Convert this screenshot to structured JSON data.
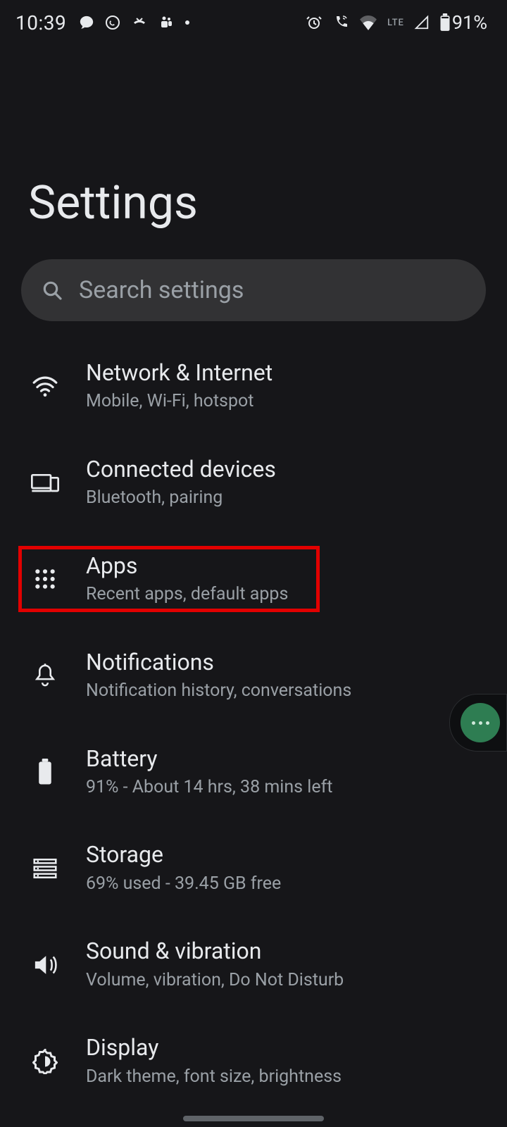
{
  "status_bar": {
    "time": "10:39",
    "battery": "91%",
    "network_indicator": "LTE"
  },
  "page": {
    "title": "Settings"
  },
  "search": {
    "placeholder": "Search settings"
  },
  "settings": [
    {
      "id": "network",
      "title": "Network & Internet",
      "subtitle": "Mobile, Wi-Fi, hotspot"
    },
    {
      "id": "connected",
      "title": "Connected devices",
      "subtitle": "Bluetooth, pairing"
    },
    {
      "id": "apps",
      "title": "Apps",
      "subtitle": "Recent apps, default apps",
      "highlighted": true
    },
    {
      "id": "notifications",
      "title": "Notifications",
      "subtitle": "Notification history, conversations"
    },
    {
      "id": "battery",
      "title": "Battery",
      "subtitle": "91% - About 14 hrs, 38 mins left"
    },
    {
      "id": "storage",
      "title": "Storage",
      "subtitle": "69% used - 39.45 GB free"
    },
    {
      "id": "sound",
      "title": "Sound & vibration",
      "subtitle": "Volume, vibration, Do Not Disturb"
    },
    {
      "id": "display",
      "title": "Display",
      "subtitle": "Dark theme, font size, brightness"
    }
  ],
  "annotations": {
    "highlight_box_color": "#e20000"
  }
}
